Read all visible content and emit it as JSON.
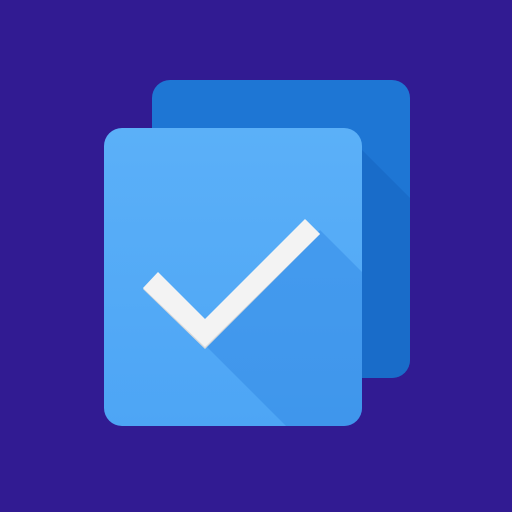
{
  "icon": {
    "semantic_name": "stacked-cards-checkmark-icon",
    "depicts": [
      "back-card",
      "front-card",
      "checkmark-icon"
    ]
  },
  "colors": {
    "background": "#311B92",
    "back_card": "#1E76D4",
    "back_card_shadow": "#1565C0",
    "front_card": "#4DA5F5",
    "front_card_light": "#5BB0F8",
    "long_shadow": "#2F86E3",
    "checkmark": "#F3F3F3",
    "checkmark_shade": "#D9D9D9"
  }
}
